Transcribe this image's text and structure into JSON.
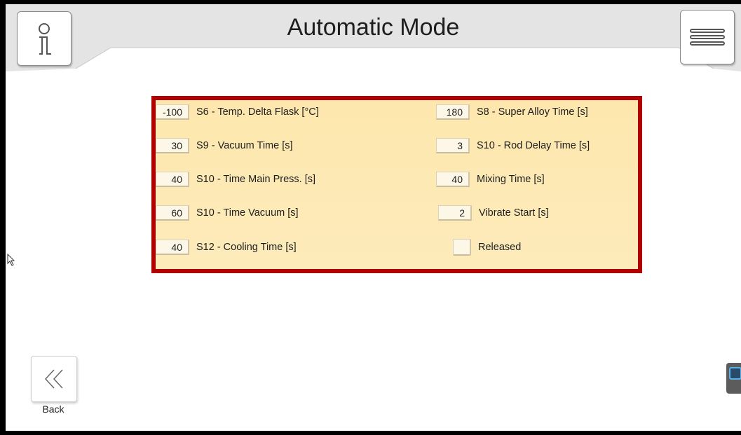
{
  "header": {
    "title": "Automatic Mode"
  },
  "icons": {
    "info": "info-icon",
    "menu": "hamburger-menu-icon",
    "back": "double-chevron-left-icon"
  },
  "colors": {
    "panel_border": "#b00000",
    "panel_fill": "#fde9b3",
    "header_bg": "#e6e6e6"
  },
  "params_left": [
    {
      "value": "-100",
      "label": "S6 - Temp. Delta Flask [°C]"
    },
    {
      "value": "30",
      "label": "S9 - Vacuum Time [s]"
    },
    {
      "value": "40",
      "label": "S10 - Time Main Press. [s]"
    },
    {
      "value": "60",
      "label": "S10 - Time Vacuum [s]"
    },
    {
      "value": "40",
      "label": "S12 - Cooling Time [s]"
    }
  ],
  "params_right": [
    {
      "value": "180",
      "label": "S8 - Super Alloy Time [s]"
    },
    {
      "value": "3",
      "label": "S10 - Rod Delay Time [s]"
    },
    {
      "value": "40",
      "label": "Mixing Time [s]"
    },
    {
      "value": "2",
      "label": "Vibrate Start [s]"
    }
  ],
  "released": {
    "label": "Released",
    "checked": false
  },
  "footer": {
    "back_label": "Back"
  }
}
